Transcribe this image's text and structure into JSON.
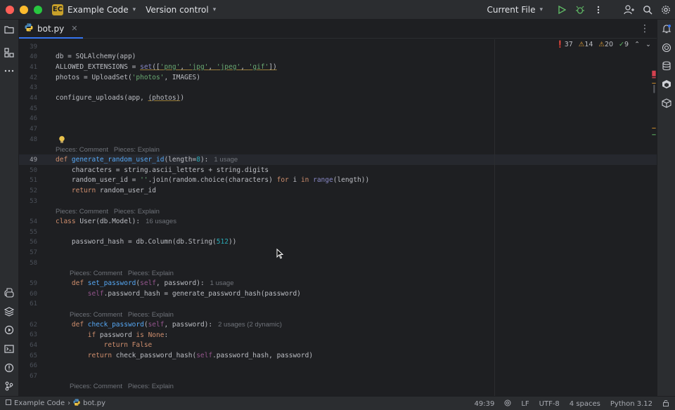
{
  "titlebar": {
    "project_badge": "EC",
    "project_name": "Example Code",
    "vcs_label": "Version control",
    "run_config": "Current File"
  },
  "tabs": [
    {
      "label": "bot.py",
      "icon": "python-file-icon"
    }
  ],
  "inspections": {
    "errors": "37",
    "warnings": "14",
    "weak_warnings": "20",
    "ok": "9"
  },
  "editor": {
    "lines": [
      {
        "n": "39"
      },
      {
        "n": "40"
      },
      {
        "n": "41"
      },
      {
        "n": "42"
      },
      {
        "n": "43"
      },
      {
        "n": "44"
      },
      {
        "n": "45"
      },
      {
        "n": "46"
      },
      {
        "n": "47"
      },
      {
        "n": "48"
      },
      {
        "n": "49"
      },
      {
        "n": "50"
      },
      {
        "n": "51"
      },
      {
        "n": "52"
      },
      {
        "n": "53"
      },
      {
        "n": "54"
      },
      {
        "n": "55"
      },
      {
        "n": "56"
      },
      {
        "n": "57"
      },
      {
        "n": "58"
      },
      {
        "n": "59"
      },
      {
        "n": "60"
      },
      {
        "n": "61"
      },
      {
        "n": "62"
      },
      {
        "n": "63"
      },
      {
        "n": "64"
      },
      {
        "n": "65"
      },
      {
        "n": "66"
      },
      {
        "n": "67"
      }
    ],
    "code": {
      "l40": "db = SQLAlchemy(app)",
      "l41_a": "ALLOWED_EXTENSIONS = ",
      "l41_b": "set",
      "l41_c": "([",
      "l41_d": "'png'",
      "l41_e": ", ",
      "l41_f": "'jpg'",
      "l41_g": ", ",
      "l41_h": "'jpeg'",
      "l41_i": ", ",
      "l41_j": "'gif'",
      "l41_k": "])",
      "l42_a": "photos = UploadSet(",
      "l42_b": "'photos'",
      "l42_c": ", IMAGES)",
      "l44_a": "configure_uploads(app, ",
      "l44_b": "(photos)",
      "l44_c": ")",
      "l49_kw": "def ",
      "l49_fn": "generate_random_user_id",
      "l49_a": "(length=",
      "l49_num": "8",
      "l49_b": "):",
      "l49_usage": "1 usage",
      "l50": "    characters = string.ascii_letters + string.digits",
      "l51_a": "    random_user_id = ",
      "l51_str": "''",
      "l51_b": ".join(random.choice(characters) ",
      "l51_for": "for ",
      "l51_i": "i ",
      "l51_in": "in ",
      "l51_range": "range",
      "l51_c": "(length))",
      "l52_kw": "    return ",
      "l52_b": "random_user_id",
      "l54_kw": "class ",
      "l54_a": "User(db.Model):",
      "l54_usage": "16 usages",
      "l56_a": "    password_hash = db.Column(db.String(",
      "l56_num": "512",
      "l56_b": "))",
      "l59_kw": "    def ",
      "l59_fn": "set_password",
      "l59_a": "(",
      "l59_self": "self",
      "l59_b": ", password):",
      "l59_usage": "1 usage",
      "l60_self": "        self",
      "l60_a": ".password_hash = generate_password_hash(password)",
      "l62_kw": "    def ",
      "l62_fn": "check_password",
      "l62_a": "(",
      "l62_self": "self",
      "l62_b": ", password):",
      "l62_usage": "2 usages (2 dynamic)",
      "l63_kw": "        if ",
      "l63_a": "password ",
      "l63_is": "is None",
      "l63_b": ":",
      "l64_kw": "            return False",
      "l65_kw": "        return ",
      "l65_a": "check_password_hash(",
      "l65_self": "self",
      "l65_b": ".password_hash, password)"
    },
    "pieces_comment": "Pieces: Comment",
    "pieces_explain": "Pieces: Explain"
  },
  "statusbar": {
    "breadcrumb_project": "Example Code",
    "breadcrumb_file": "bot.py",
    "position": "49:39",
    "line_sep": "LF",
    "encoding": "UTF-8",
    "indent": "4 spaces",
    "interpreter": "Python 3.12"
  },
  "colors": {
    "accent": "#3574f0",
    "error": "#f75464",
    "warning": "#e0a039",
    "ok": "#5fb865"
  }
}
